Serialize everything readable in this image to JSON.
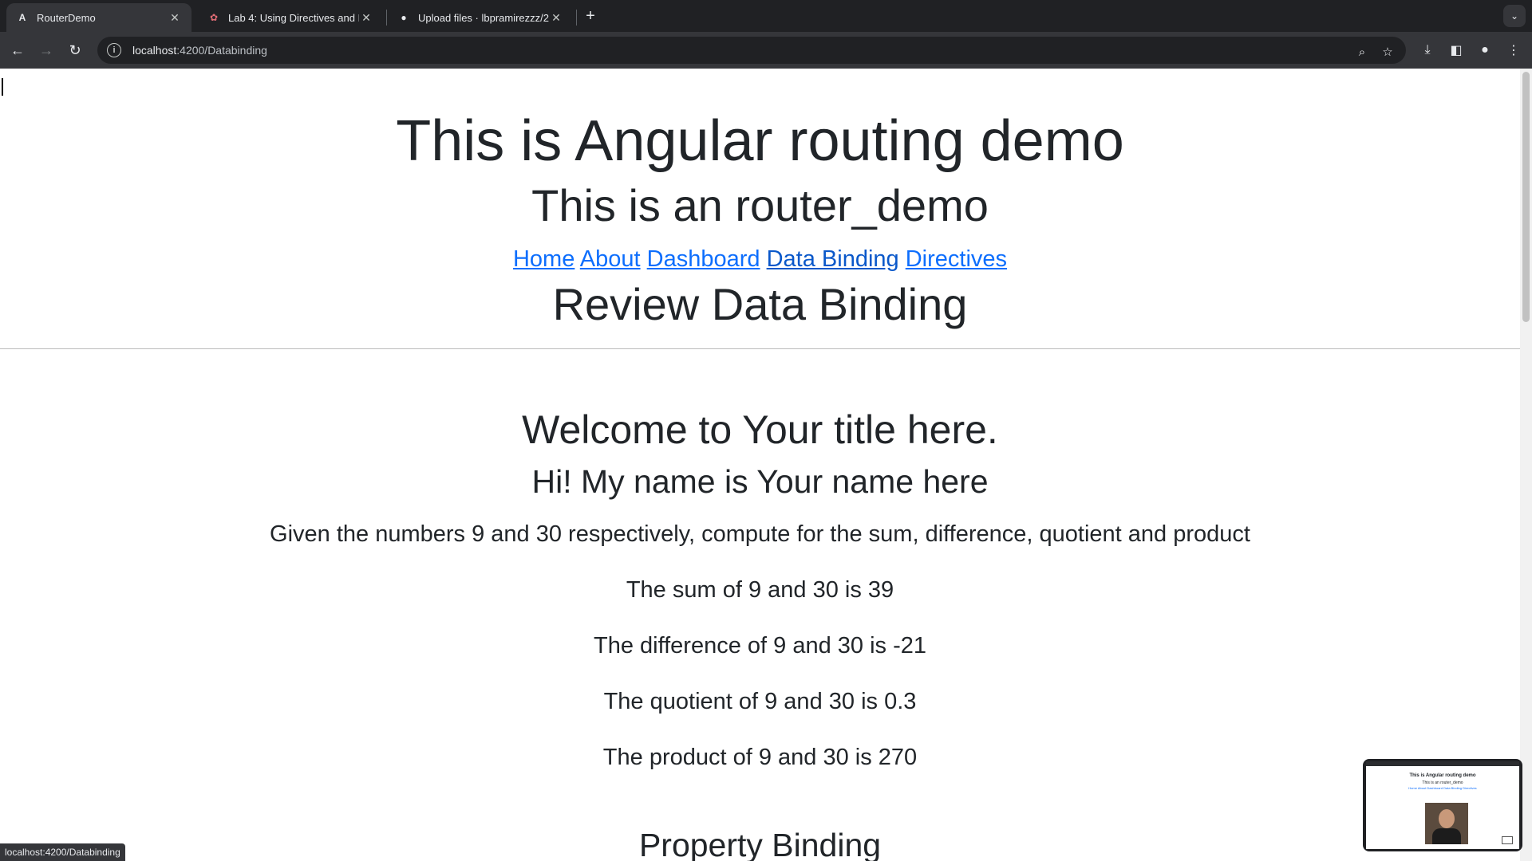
{
  "browser": {
    "tabs": [
      {
        "title": "RouterDemo",
        "icon": "angular-icon",
        "active": true
      },
      {
        "title": "Lab 4: Using Directives and R",
        "icon": "lab-icon",
        "active": false
      },
      {
        "title": "Upload files · lbpramirezzz/2",
        "icon": "github-icon",
        "active": false
      }
    ],
    "new_tab": "+",
    "url_host": "localhost",
    "url_path": ":4200/Databinding",
    "status_url": "localhost:4200/Databinding"
  },
  "page": {
    "title": "This is Angular routing demo",
    "subtitle": "This is an router_demo",
    "nav": [
      "Home",
      "About",
      "Dashboard",
      "Data Binding",
      "Directives"
    ],
    "section_title": "Review Data Binding",
    "welcome": "Welcome to Your title here.",
    "greeting": "Hi! My name is Your name here",
    "given": "Given the numbers 9 and 30 respectively, compute for the sum, difference, quotient and product",
    "results": [
      "The sum of 9 and 30 is 39",
      "The difference of 9 and 30 is -21",
      "The quotient of 9 and 30 is 0.3",
      "The product of 9 and 30 is 270"
    ],
    "property_binding": "Property Binding"
  },
  "pip": {
    "title": "This is Angular routing demo",
    "subtitle": "This is an router_demo",
    "nav": "Home About Dashboard Data Binding Directives"
  },
  "colors": {
    "link": "#0d6efd",
    "text": "#212529",
    "chrome": "#35363a"
  }
}
